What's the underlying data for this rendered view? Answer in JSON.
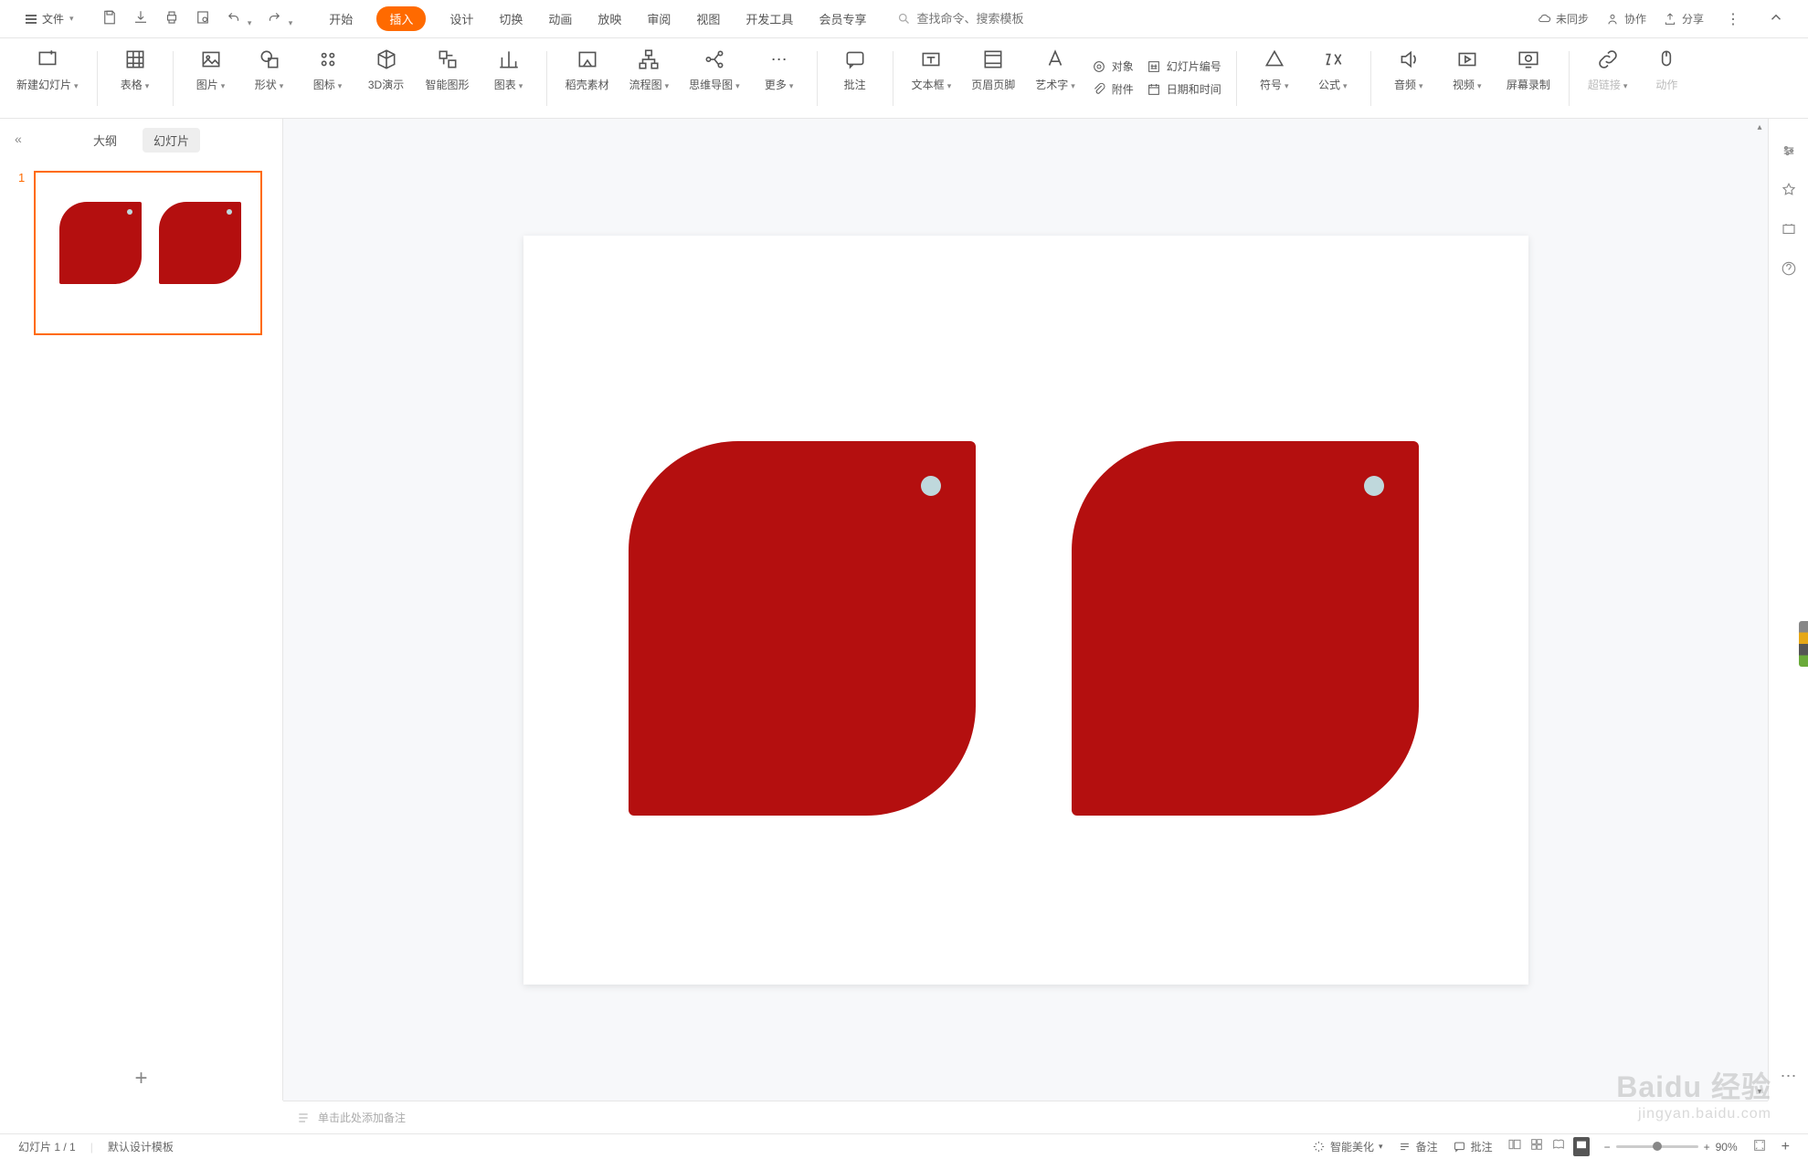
{
  "top": {
    "file_label": "文件",
    "tabs": [
      "开始",
      "插入",
      "设计",
      "切换",
      "动画",
      "放映",
      "审阅",
      "视图",
      "开发工具",
      "会员专享"
    ],
    "active_tab_index": 1,
    "search_placeholder": "查找命令、搜索模板",
    "sync_label": "未同步",
    "collab_label": "协作",
    "share_label": "分享"
  },
  "ribbon": {
    "new_slide": "新建幻灯片",
    "table": "表格",
    "image": "图片",
    "shape": "形状",
    "icon": "图标",
    "three_d": "3D演示",
    "smart_art": "智能图形",
    "chart": "图表",
    "template": "稻壳素材",
    "flowchart": "流程图",
    "mindmap": "思维导图",
    "more": "更多",
    "comment": "批注",
    "textbox": "文本框",
    "header_footer": "页眉页脚",
    "wordart": "艺术字",
    "object": "对象",
    "slide_num": "幻灯片编号",
    "attachment": "附件",
    "date_time": "日期和时间",
    "symbol": "符号",
    "equation": "公式",
    "audio": "音频",
    "video": "视频",
    "screen_rec": "屏幕录制",
    "hyperlink": "超链接",
    "action": "动作"
  },
  "panel": {
    "outline_tab": "大纲",
    "slides_tab": "幻灯片",
    "slide_number": "1"
  },
  "notes": {
    "placeholder": "单击此处添加备注"
  },
  "status": {
    "slide_indicator": "幻灯片 1 / 1",
    "template_label": "默认设计模板",
    "smart_beautify": "智能美化",
    "notes": "备注",
    "comments": "批注",
    "zoom_value": "90%"
  },
  "watermark": {
    "main": "Baidu 经验",
    "sub": "jingyan.baidu.com"
  }
}
